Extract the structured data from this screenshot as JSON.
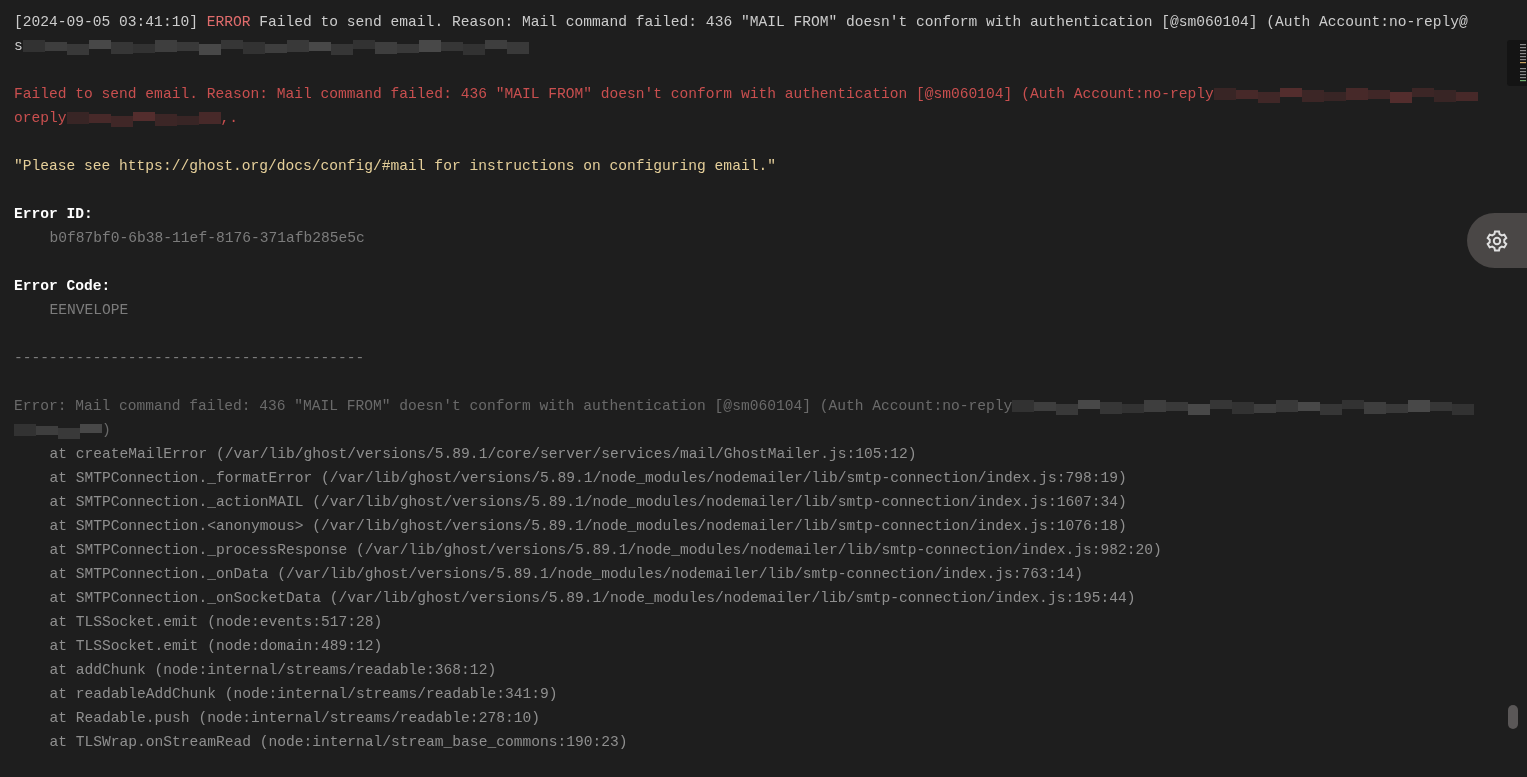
{
  "lines": [
    {
      "kind": "text",
      "segments": [
        {
          "kind": "plain",
          "text": "[2024-09-05 03:41:10] "
        },
        {
          "kind": "level",
          "text": "ERROR"
        },
        {
          "kind": "plain",
          "text": " Failed to send email. Reason: Mail command failed: 436 \"MAIL FROM\" doesn't conform with authentication [@sm060104] (Auth Account:no-reply@"
        }
      ]
    },
    {
      "kind": "text",
      "segments": [
        {
          "kind": "plain",
          "text": "s"
        },
        {
          "kind": "redacted"
        }
      ]
    },
    {
      "kind": "blank"
    },
    {
      "kind": "text",
      "segments": [
        {
          "kind": "error",
          "text": "Failed to send email. Reason: Mail command failed: 436 \"MAIL FROM\" doesn't conform with authentication [@sm060104] (Auth Account:no-reply"
        },
        {
          "kind": "redacted"
        }
      ]
    },
    {
      "kind": "text",
      "segments": [
        {
          "kind": "error",
          "text": "oreply"
        },
        {
          "kind": "redacted"
        },
        {
          "kind": "error",
          "text": ",."
        }
      ]
    },
    {
      "kind": "blank"
    },
    {
      "kind": "text",
      "segments": [
        {
          "kind": "string",
          "text": "\"Please see https://ghost.org/docs/config/#mail for instructions on configuring email.\""
        }
      ]
    },
    {
      "kind": "blank"
    },
    {
      "kind": "text",
      "segments": [
        {
          "kind": "heading",
          "text": "Error ID:"
        }
      ]
    },
    {
      "kind": "indented",
      "segments": [
        {
          "kind": "muted",
          "text": "b0f87bf0-6b38-11ef-8176-371afb285e5c"
        }
      ]
    },
    {
      "kind": "blank"
    },
    {
      "kind": "text",
      "segments": [
        {
          "kind": "heading",
          "text": "Error Code:"
        }
      ]
    },
    {
      "kind": "indented",
      "segments": [
        {
          "kind": "muted",
          "text": "EENVELOPE"
        }
      ]
    },
    {
      "kind": "blank"
    },
    {
      "kind": "text",
      "segments": [
        {
          "kind": "muted",
          "text": "----------------------------------------"
        }
      ]
    },
    {
      "kind": "blank"
    },
    {
      "kind": "text",
      "segments": [
        {
          "kind": "dim",
          "text": "Error: Mail command failed: 436 \"MAIL FROM\" doesn't conform with authentication [@sm060104] (Auth Account:no-reply"
        },
        {
          "kind": "redacted"
        }
      ]
    },
    {
      "kind": "text",
      "segments": [
        {
          "kind": "redacted"
        },
        {
          "kind": "dim",
          "text": ")"
        }
      ]
    },
    {
      "kind": "indented",
      "segments": [
        {
          "kind": "stack",
          "text": "at createMailError (/var/lib/ghost/versions/5.89.1/core/server/services/mail/GhostMailer.js:105:12)"
        }
      ]
    },
    {
      "kind": "indented",
      "segments": [
        {
          "kind": "stack",
          "text": "at SMTPConnection._formatError (/var/lib/ghost/versions/5.89.1/node_modules/nodemailer/lib/smtp-connection/index.js:798:19)"
        }
      ]
    },
    {
      "kind": "indented",
      "segments": [
        {
          "kind": "stack",
          "text": "at SMTPConnection._actionMAIL (/var/lib/ghost/versions/5.89.1/node_modules/nodemailer/lib/smtp-connection/index.js:1607:34)"
        }
      ]
    },
    {
      "kind": "indented",
      "segments": [
        {
          "kind": "stack",
          "text": "at SMTPConnection.<anonymous> (/var/lib/ghost/versions/5.89.1/node_modules/nodemailer/lib/smtp-connection/index.js:1076:18)"
        }
      ]
    },
    {
      "kind": "indented",
      "segments": [
        {
          "kind": "stack",
          "text": "at SMTPConnection._processResponse (/var/lib/ghost/versions/5.89.1/node_modules/nodemailer/lib/smtp-connection/index.js:982:20)"
        }
      ]
    },
    {
      "kind": "indented",
      "segments": [
        {
          "kind": "stack",
          "text": "at SMTPConnection._onData (/var/lib/ghost/versions/5.89.1/node_modules/nodemailer/lib/smtp-connection/index.js:763:14)"
        }
      ]
    },
    {
      "kind": "indented",
      "segments": [
        {
          "kind": "stack",
          "text": "at SMTPConnection._onSocketData (/var/lib/ghost/versions/5.89.1/node_modules/nodemailer/lib/smtp-connection/index.js:195:44)"
        }
      ]
    },
    {
      "kind": "indented",
      "segments": [
        {
          "kind": "stack",
          "text": "at TLSSocket.emit (node:events:517:28)"
        }
      ]
    },
    {
      "kind": "indented",
      "segments": [
        {
          "kind": "stack",
          "text": "at TLSSocket.emit (node:domain:489:12)"
        }
      ]
    },
    {
      "kind": "indented",
      "segments": [
        {
          "kind": "stack",
          "text": "at addChunk (node:internal/streams/readable:368:12)"
        }
      ]
    },
    {
      "kind": "indented",
      "segments": [
        {
          "kind": "stack",
          "text": "at readableAddChunk (node:internal/streams/readable:341:9)"
        }
      ]
    },
    {
      "kind": "indented",
      "segments": [
        {
          "kind": "stack",
          "text": "at Readable.push (node:internal/streams/readable:278:10)"
        }
      ]
    },
    {
      "kind": "indented",
      "segments": [
        {
          "kind": "stack",
          "text": "at TLSWrap.onStreamRead (node:internal/stream_base_commons:190:23)"
        }
      ]
    }
  ]
}
